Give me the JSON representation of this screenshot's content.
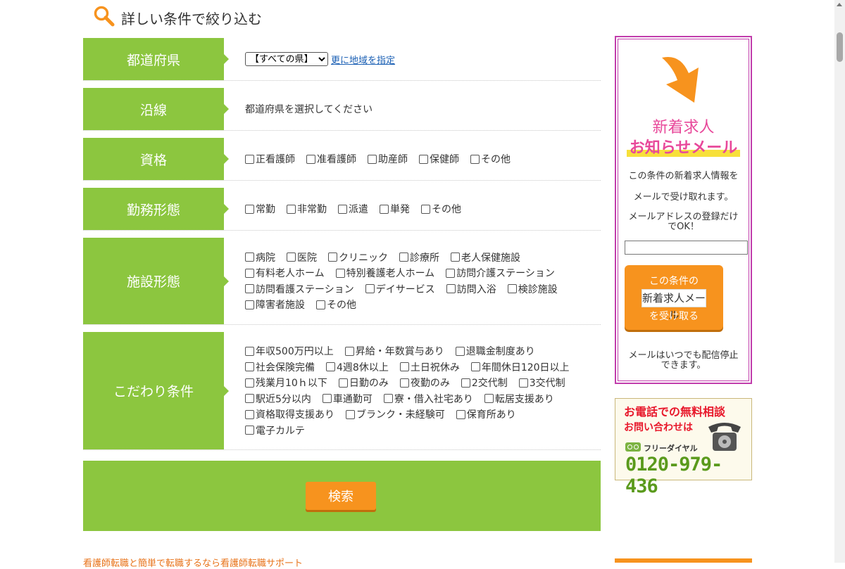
{
  "heading": {
    "title": "詳しい条件で絞り込む"
  },
  "rows": [
    {
      "label": "都道府県"
    },
    {
      "label": "沿線",
      "text": "都道府県を選択してください"
    },
    {
      "label": "資格"
    },
    {
      "label": "勤務形態"
    },
    {
      "label": "施設形態"
    },
    {
      "label": "こだわり条件"
    }
  ],
  "prefecture": {
    "selected": "【すべての県】",
    "link": "更に地域を指定"
  },
  "qualifications": [
    "正看護師",
    "准看護師",
    "助産師",
    "保健師",
    "その他"
  ],
  "employment": [
    "常勤",
    "非常勤",
    "派遣",
    "単発",
    "その他"
  ],
  "facilities": {
    "line1": [
      "病院",
      "医院",
      "クリニック",
      "診療所",
      "老人保健施設"
    ],
    "line2": [
      "有料老人ホーム",
      "特別養護老人ホーム",
      "訪問介護ステーション"
    ],
    "line3": [
      "訪問看護ステーション",
      "デイサービス",
      "訪問入浴",
      "検診施設"
    ],
    "line4": [
      "障害者施設",
      "その他"
    ]
  },
  "preferences": {
    "line1": [
      "年収500万円以上",
      "昇給・年数賞与あり",
      "退職金制度あり"
    ],
    "line2": [
      "社会保険完備",
      "4週8休以上",
      "土日祝休み",
      "年間休日120日以上"
    ],
    "line3": [
      "残業月10ｈ以下",
      "日勤のみ",
      "夜勤のみ",
      "2交代制",
      "3交代制"
    ],
    "line4": [
      "駅近5分以内",
      "車通勤可",
      "寮・借入社宅あり",
      "転居支援あり"
    ],
    "line5": [
      "資格取得支援あり",
      "ブランク・未経験可",
      "保育所あり"
    ],
    "line6": [
      "電子カルテ"
    ]
  },
  "search": {
    "button": "検索"
  },
  "sidebar": {
    "title1": "新着求人",
    "title2": "お知らせメール",
    "text1": "この条件の新着求人情報を",
    "text2": "メールで受け取れます。",
    "text3": "メールアドレスの登録だけでOK！",
    "btn_top": "この条件の",
    "btn_mid": "新着求人メール",
    "btn_bottom": "を受け取る",
    "note": "メールはいつでも配信停止できます。"
  },
  "phone": {
    "line1": "お電話での無料相談",
    "line2": "お問い合わせは",
    "label": "フリーダイヤル",
    "number": "0120-979-436"
  },
  "footer": {
    "link": "看護師転職と簡単で転職するなら看護師転職サポート"
  },
  "colors": {
    "green": "#8cc63f",
    "orange": "#f7931e",
    "pink": "#e8489a",
    "magenta": "#c13dac"
  }
}
